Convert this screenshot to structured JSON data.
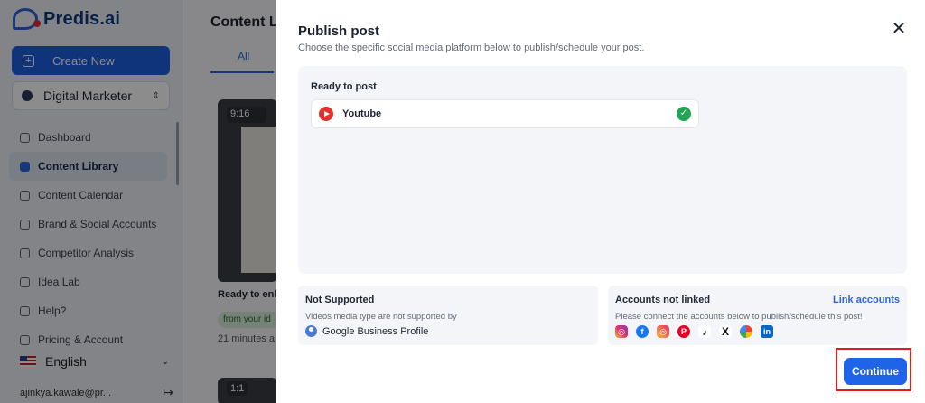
{
  "sidebar": {
    "logo_text": "Predis.ai",
    "create_label": "Create New",
    "workspace": "Digital Marketer",
    "items": [
      {
        "label": "Dashboard"
      },
      {
        "label": "Content Library"
      },
      {
        "label": "Content Calendar"
      },
      {
        "label": "Brand & Social Accounts"
      },
      {
        "label": "Competitor Analysis"
      },
      {
        "label": "Idea Lab"
      },
      {
        "label": "Help?"
      },
      {
        "label": "Pricing & Account"
      }
    ],
    "language": "English",
    "user_email": "ajinkya.kawale@pr...",
    "logout_symbol": "↦"
  },
  "main": {
    "title": "Content Li",
    "tab_all": "All",
    "card_duration": "9:16",
    "card_label": "Ready to enha",
    "card_chip": "from your id",
    "card_time": "21 minutes a",
    "card2_ratio": "1:1"
  },
  "modal": {
    "title": "Publish post",
    "subtitle": "Choose the specific social media platform below to publish/schedule your post.",
    "close_symbol": "✕",
    "ready_label": "Ready to post",
    "ready_platform": "Youtube",
    "check_symbol": "✓",
    "not_supported": {
      "title": "Not Supported",
      "description": "Videos media type are not supported by",
      "platform": "Google Business Profile"
    },
    "accounts_not_linked": {
      "title": "Accounts not linked",
      "link_label": "Link accounts",
      "description": "Please connect the accounts below to publish/schedule this post!",
      "icons": [
        {
          "name": "instagram-icon",
          "glyph": "◎"
        },
        {
          "name": "facebook-icon",
          "glyph": "f"
        },
        {
          "name": "instagram-story-icon",
          "glyph": "◎"
        },
        {
          "name": "pinterest-icon",
          "glyph": "P"
        },
        {
          "name": "tiktok-icon",
          "glyph": "♪"
        },
        {
          "name": "x-icon",
          "glyph": "X"
        },
        {
          "name": "google-icon",
          "glyph": ""
        },
        {
          "name": "linkedin-icon",
          "glyph": "in"
        }
      ]
    },
    "continue_label": "Continue"
  },
  "colors": {
    "accent": "#1e63e8",
    "success": "#21a454",
    "highlight_border": "#e01e1e",
    "youtube": "#e1322d"
  }
}
